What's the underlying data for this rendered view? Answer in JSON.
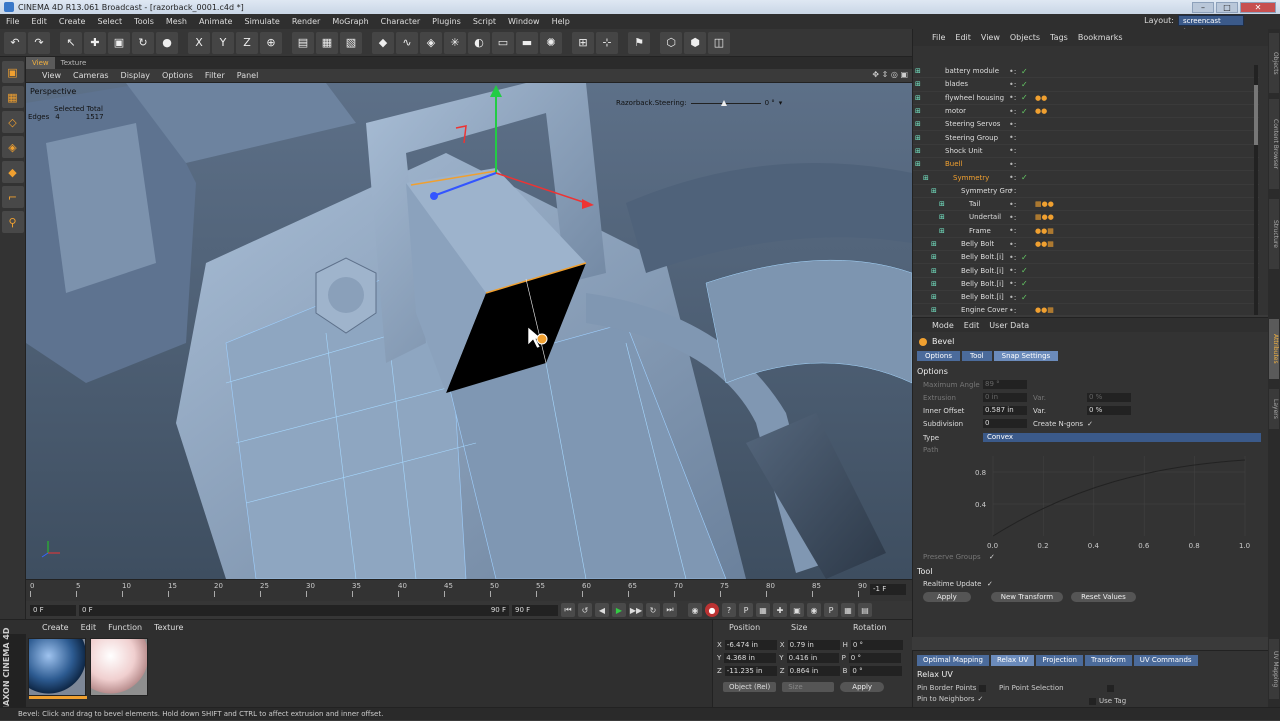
{
  "window": {
    "title": "CINEMA 4D R13.061 Broadcast - [razorback_0001.c4d *]",
    "min": "–",
    "max": "□",
    "close": "✕"
  },
  "menubar": {
    "items": [
      "File",
      "Edit",
      "Create",
      "Select",
      "Tools",
      "Mesh",
      "Animate",
      "Simulate",
      "Render",
      "MoGraph",
      "Character",
      "Plugins",
      "Script",
      "Window",
      "Help"
    ],
    "layout_label": "Layout:",
    "layout_value": "screencast (User)"
  },
  "toolbar": {
    "icons": [
      "undo-icon",
      "redo-icon",
      "sep",
      "select-icon",
      "move-icon",
      "scale-icon",
      "rotate-icon",
      "live-select-icon",
      "sep",
      "x-axis-icon",
      "y-axis-icon",
      "z-axis-icon",
      "world-icon",
      "sep",
      "render-view-icon",
      "render-picture-icon",
      "render-settings-icon",
      "sep",
      "cube-icon",
      "spline-icon",
      "nurbs-icon",
      "array-icon",
      "deformer-icon",
      "scene-icon",
      "camera-icon",
      "light-icon",
      "sep",
      "edit-icon",
      "snap-icon",
      "sep",
      "tweak-icon",
      "sep",
      "points-mode-icon",
      "edges-mode-icon",
      "polygons-mode-icon"
    ],
    "glyphs": {
      "undo-icon": "↶",
      "redo-icon": "↷",
      "select-icon": "↖",
      "move-icon": "✚",
      "scale-icon": "▣",
      "rotate-icon": "↻",
      "live-select-icon": "●",
      "x-axis-icon": "X",
      "y-axis-icon": "Y",
      "z-axis-icon": "Z",
      "world-icon": "⊕",
      "render-view-icon": "▤",
      "render-picture-icon": "▦",
      "render-settings-icon": "▧",
      "cube-icon": "◆",
      "spline-icon": "∿",
      "nurbs-icon": "◈",
      "array-icon": "✳",
      "deformer-icon": "◐",
      "scene-icon": "▭",
      "camera-icon": "▬",
      "light-icon": "✺",
      "edit-icon": "⊞",
      "snap-icon": "⊹",
      "tweak-icon": "⚑",
      "points-mode-icon": "⬡",
      "edges-mode-icon": "⬢",
      "polygons-mode-icon": "◫"
    }
  },
  "lefttools": [
    "model-mode-icon",
    "texture-mode-icon",
    "points-icon",
    "edges-icon",
    "polygons-icon",
    "axis-icon",
    "magnet-icon"
  ],
  "lefttool_glyphs": [
    "▣",
    "▦",
    "◇",
    "◈",
    "◆",
    "⌐",
    "⚲"
  ],
  "viewport": {
    "tabs": [
      "View",
      "Texture"
    ],
    "menu": [
      "View",
      "Cameras",
      "Display",
      "Options",
      "Filter",
      "Panel"
    ],
    "nav_icons": "✥ ⇕ ◎ ▣",
    "label": "Perspective",
    "stats_header": "Selected Total",
    "stats_row_label": "Edges",
    "stats_selected": "4",
    "stats_total": "1517",
    "steer_label": "Razorback.Steering:",
    "steer_value": "0 °",
    "steer_arrow": "▾"
  },
  "timeline": {
    "ticks": [
      "0",
      "5",
      "10",
      "15",
      "20",
      "25",
      "30",
      "35",
      "40",
      "45",
      "50",
      "55",
      "60",
      "65",
      "70",
      "75",
      "80",
      "85",
      "90"
    ],
    "current_frame": "-1 F"
  },
  "transport": {
    "start": "0 F",
    "range_start": "0 F",
    "range_end": "90 F",
    "end": "90 F",
    "buttons": [
      "⏮",
      "↺",
      "◀",
      "▶",
      "▶▶",
      "↻",
      "⏭",
      "◉",
      "●",
      "?",
      "P",
      "▦",
      "✚",
      "▣",
      "◉",
      "P",
      "▦",
      "▤"
    ]
  },
  "materials": {
    "menu": [
      "Create",
      "Edit",
      "Function",
      "Texture"
    ],
    "brand": "MAXON CINEMA 4D"
  },
  "coords": {
    "headers": [
      "Position",
      "Size",
      "Rotation"
    ],
    "rows": [
      {
        "axis": "X",
        "pos": "-6.474 in",
        "saxis": "X",
        "size": "0.79 in",
        "raxis": "H",
        "rot": "0 °"
      },
      {
        "axis": "Y",
        "pos": "4.368 in",
        "saxis": "Y",
        "size": "0.416 in",
        "raxis": "P",
        "rot": "0 °"
      },
      {
        "axis": "Z",
        "pos": "-11.235 in",
        "saxis": "Z",
        "size": "0.864 in",
        "raxis": "B",
        "rot": "0 °"
      }
    ],
    "mode": "Object (Rel)",
    "size_mode": "Size",
    "apply": "Apply"
  },
  "objects": {
    "menu": [
      "File",
      "Edit",
      "View",
      "Objects",
      "Tags",
      "Bookmarks"
    ],
    "rows": [
      {
        "name": "battery module",
        "indent": 0,
        "hl": false,
        "check": "✓",
        "tag": ""
      },
      {
        "name": "blades",
        "indent": 0,
        "hl": false,
        "check": "✓",
        "tag": ""
      },
      {
        "name": "flywheel housing",
        "indent": 0,
        "hl": false,
        "check": "✓",
        "tag": "●●"
      },
      {
        "name": "motor",
        "indent": 0,
        "hl": false,
        "check": "✓",
        "tag": "●●"
      },
      {
        "name": "Steering Servos",
        "indent": 0,
        "hl": false,
        "check": "",
        "tag": ""
      },
      {
        "name": "Steering Group",
        "indent": 0,
        "hl": false,
        "check": "",
        "tag": ""
      },
      {
        "name": "Shock Unit",
        "indent": 0,
        "hl": false,
        "check": "",
        "tag": ""
      },
      {
        "name": "Buell",
        "indent": 0,
        "hl": true,
        "check": "",
        "tag": ""
      },
      {
        "name": "Symmetry",
        "indent": 1,
        "hl": true,
        "check": "✓",
        "tag": ""
      },
      {
        "name": "Symmetry Gro",
        "indent": 2,
        "hl": false,
        "check": "",
        "tag": ""
      },
      {
        "name": "Tail",
        "indent": 3,
        "hl": false,
        "check": "",
        "tag": "▦●●"
      },
      {
        "name": "Undertail",
        "indent": 3,
        "hl": false,
        "check": "",
        "tag": "▦●●"
      },
      {
        "name": "Frame",
        "indent": 3,
        "hl": false,
        "check": "",
        "tag": "●●▦"
      },
      {
        "name": "Belly Bolt",
        "indent": 2,
        "hl": false,
        "check": "",
        "tag": "●●▦"
      },
      {
        "name": "Belly Bolt.[i]",
        "indent": 2,
        "hl": false,
        "check": "✓",
        "tag": ""
      },
      {
        "name": "Belly Bolt.[i]",
        "indent": 2,
        "hl": false,
        "check": "✓",
        "tag": ""
      },
      {
        "name": "Belly Bolt.[i]",
        "indent": 2,
        "hl": false,
        "check": "✓",
        "tag": ""
      },
      {
        "name": "Belly Bolt.[i]",
        "indent": 2,
        "hl": false,
        "check": "✓",
        "tag": ""
      },
      {
        "name": "Engine Cover",
        "indent": 2,
        "hl": false,
        "check": "",
        "tag": "●●▦"
      }
    ]
  },
  "attributes": {
    "menu": [
      "Mode",
      "Edit",
      "User Data"
    ],
    "title": "Bevel",
    "tabs": [
      "Options",
      "Tool",
      "Snap Settings"
    ],
    "section_options": "Options",
    "max_angle_label": "Maximum Angle",
    "max_angle": "89 °",
    "extrusion_label": "Extrusion",
    "extrusion": "0 in",
    "var_label": "Var.",
    "var1": "0 %",
    "inner_label": "Inner Offset",
    "inner": "0.587 in",
    "var2": "0 %",
    "subdiv_label": "Subdivision",
    "subdiv": "0",
    "ngons_label": "Create N-gons",
    "ngons_check": "✓",
    "type_label": "Type",
    "type_value": "Convex",
    "path_label": "Path",
    "preserve_label": "Preserve Groups",
    "preserve_check": "✓",
    "section_tool": "Tool",
    "realtime_label": "Realtime Update",
    "realtime_check": "✓",
    "apply": "Apply",
    "new_transform": "New Transform",
    "reset": "Reset Values",
    "curve_x": [
      "0.0",
      "0.2",
      "0.4",
      "0.6",
      "0.8",
      "1.0"
    ],
    "curve_y": [
      "0.8",
      "0.4"
    ]
  },
  "uv": {
    "tabs": [
      "Optimal Mapping",
      "Relax UV",
      "Projection",
      "Transform",
      "UV Commands"
    ],
    "section": "Relax UV",
    "pin_border": "Pin Border Points",
    "pin_neighbors": "Pin to Neighbors",
    "pin_check": "✓",
    "pin_selection": "Pin Point Selection",
    "use_tag": "Use Tag"
  },
  "side_tabs": [
    "Objects",
    "Content Browser",
    "Structure",
    "Attributes",
    "Layers",
    "UV Mapping"
  ],
  "statusbar": "Bevel: Click and drag to bevel elements. Hold down SHIFT and CTRL to affect extrusion and inner offset."
}
